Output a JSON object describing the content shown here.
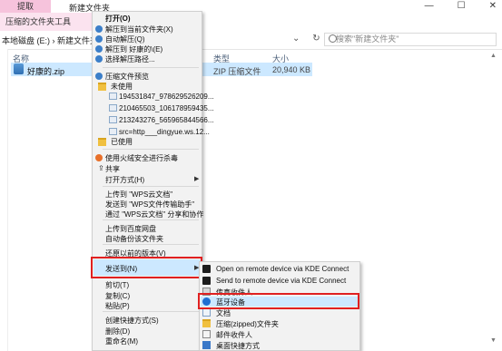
{
  "ribbon": {
    "context_tab": "提取",
    "context_subtab": "压缩的文件夹工具",
    "window_title": "新建文件夹",
    "minimize": "—",
    "maximize": "☐",
    "close": "✕"
  },
  "address": {
    "breadcrumb": "本地磁盘 (E:)  ›  新建文件夹  ›",
    "dropdown_glyph": "⌄",
    "refresh_glyph": "↻",
    "search_placeholder": "搜索\"新建文件夹\""
  },
  "columns": {
    "name": "名称",
    "type": "类型",
    "size": "大小"
  },
  "file": {
    "name": "好康的.zip",
    "type": "ZIP 压缩文件",
    "size": "20,940 KB"
  },
  "context_menu": {
    "open": "打开(O)",
    "extract_here": "解压到当前文件夹(X)",
    "auto_extract": "自动解压(Q)",
    "extract_to": "解压到 好康的\\(E)",
    "choose_extract_path": "选择解压路径...",
    "preview": "压缩文件预览",
    "unused_folder": "未使用",
    "preview_files": [
      "194531847_978629526209...",
      "210465503_106178959435...",
      "213243276_565965844566...",
      "src=http___dingyue.ws.12..."
    ],
    "used_folder": "已使用",
    "virus_scan": "使用火绒安全进行杀毒",
    "share": "共享",
    "open_with": "打开方式(H)",
    "upload_wps": "上传到 \"WPS云文档\"",
    "send_wps_helper": "发送到 \"WPS文件传输助手\"",
    "share_wps": "通过 \"WPS云文档\" 分享和协作",
    "upload_baidu": "上传到百度网盘",
    "auto_backup": "自动备份该文件夹",
    "restore_prev": "还原以前的版本(V)",
    "send_to": "发送到(N)",
    "cut": "剪切(T)",
    "copy": "复制(C)",
    "paste": "粘贴(P)",
    "create_shortcut": "创建快捷方式(S)",
    "delete": "删除(D)",
    "rename": "重命名(M)"
  },
  "send_to_menu": {
    "items": [
      "Open on remote device via KDE Connect",
      "Send to remote device via KDE Connect",
      "传真收件人",
      "蓝牙设备",
      "文档",
      "压缩(zipped)文件夹",
      "邮件收件人",
      "桌面快捷方式"
    ]
  },
  "colors": {
    "highlight": "#cce8ff",
    "annotation_red": "#e02020",
    "context_tab_pink": "#f6c3dc"
  }
}
